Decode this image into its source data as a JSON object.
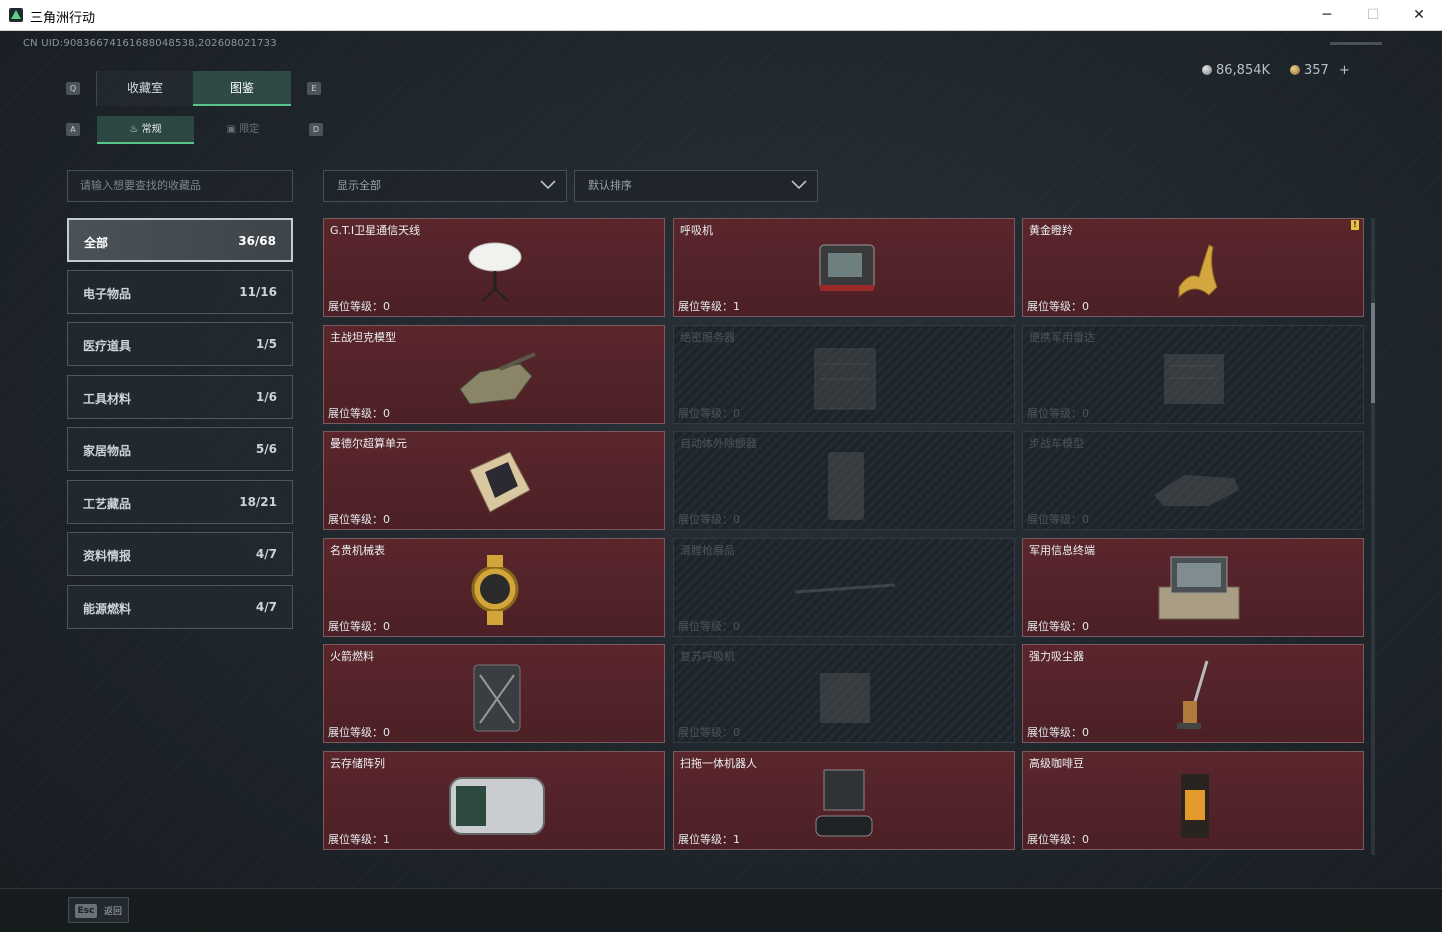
{
  "window": {
    "title": "三角洲行动",
    "minimize": "─",
    "maximize": "☐",
    "close": "✕"
  },
  "header": {
    "uid": "CN UID:9083667416168804853​8,202608021733",
    "currency_silver": "86,854K",
    "currency_gold": "357",
    "add_label": "+"
  },
  "tabs": {
    "key_left": "Q",
    "key_right": "E",
    "items": [
      {
        "label": "收藏室",
        "active": false
      },
      {
        "label": "图鉴",
        "active": true
      }
    ],
    "sub_key_left": "A",
    "sub_key_right": "D",
    "sub_items": [
      {
        "label": "常规",
        "active": true
      },
      {
        "label": "限定",
        "active": false
      }
    ]
  },
  "search": {
    "placeholder": "请输入想要查找的收藏品"
  },
  "filters": {
    "show": "显示全部",
    "sort": "默认排序"
  },
  "categories": [
    {
      "label": "全部",
      "count": "36/68",
      "active": true
    },
    {
      "label": "电子物品",
      "count": "11/16"
    },
    {
      "label": "医疗道具",
      "count": "1/5"
    },
    {
      "label": "工具材料",
      "count": "1/6"
    },
    {
      "label": "家居物品",
      "count": "5/6"
    },
    {
      "label": "工艺藏品",
      "count": "18/21"
    },
    {
      "label": "资料情报",
      "count": "4/7"
    },
    {
      "label": "能源燃料",
      "count": "4/7"
    }
  ],
  "level_prefix": "展位等级：",
  "items": [
    {
      "name": "G.T.I卫星通信天线",
      "level": "0",
      "owned": true,
      "icon": "satellite-dish"
    },
    {
      "name": "呼吸机",
      "level": "1",
      "owned": true,
      "icon": "ventilator"
    },
    {
      "name": "黄金瞪羚",
      "level": "0",
      "owned": true,
      "icon": "golden-gazelle",
      "badge": "!"
    },
    {
      "name": "主战坦克模型",
      "level": "0",
      "owned": true,
      "icon": "tank-model"
    },
    {
      "name": "绝密服务器",
      "level": "0",
      "owned": false,
      "icon": "server"
    },
    {
      "name": "便携军用雷达",
      "level": "0",
      "owned": false,
      "icon": "radar"
    },
    {
      "name": "曼德尔超算单元",
      "level": "0",
      "owned": true,
      "icon": "compute-unit"
    },
    {
      "name": "自动体外除颤器",
      "level": "0",
      "owned": false,
      "icon": "defibrillator"
    },
    {
      "name": "步战车模型",
      "level": "0",
      "owned": false,
      "icon": "ifv-model"
    },
    {
      "name": "名贵机械表",
      "level": "0",
      "owned": true,
      "icon": "watch"
    },
    {
      "name": "滑膛枪展品",
      "level": "0",
      "owned": false,
      "icon": "musket"
    },
    {
      "name": "军用信息终端",
      "level": "0",
      "owned": true,
      "icon": "terminal-case"
    },
    {
      "name": "火箭燃料",
      "level": "0",
      "owned": true,
      "icon": "fuel-can"
    },
    {
      "name": "复苏呼吸机",
      "level": "0",
      "owned": false,
      "icon": "resuscitator"
    },
    {
      "name": "强力吸尘器",
      "level": "0",
      "owned": true,
      "icon": "vacuum"
    },
    {
      "name": "云存储阵列",
      "level": "1",
      "owned": true,
      "icon": "storage-array"
    },
    {
      "name": "扫拖一体机器人",
      "level": "1",
      "owned": true,
      "icon": "robot-vacuum"
    },
    {
      "name": "高级咖啡豆",
      "level": "0",
      "owned": true,
      "icon": "coffee-beans"
    }
  ],
  "footer": {
    "esc_key": "Esc",
    "esc_label": "返回"
  },
  "colors": {
    "accent": "#58c48a",
    "owned_card": "#5a262c",
    "badge": "#e8c340"
  }
}
